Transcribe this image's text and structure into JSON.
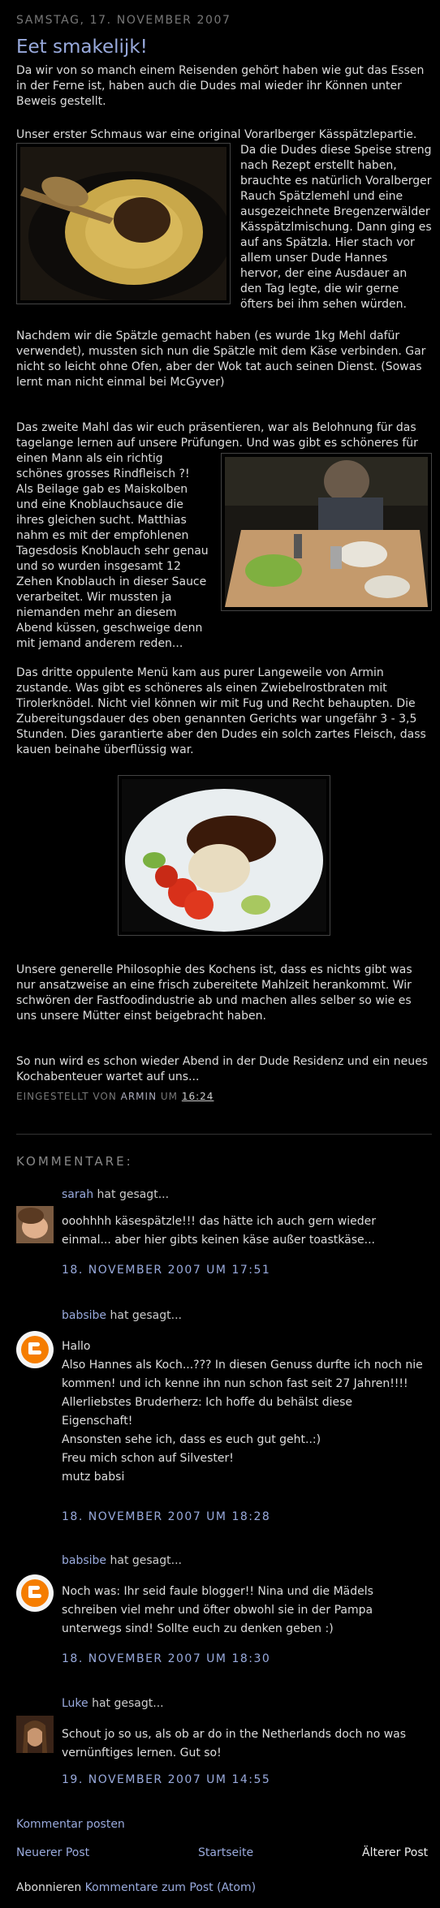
{
  "post": {
    "date": "Samstag, 17. November 2007",
    "title": "Eet smakelijk!",
    "p1": "Da wir von so manch einem Reisenden gehört haben wie gut das Essen in der Ferne ist, haben auch die Dudes mal wieder ihr Können unter Beweis gestellt.",
    "p2_intro": "Unser erster Schmaus war eine original Vorarlberger Kässpätzlepartie.",
    "p2_beside": "Da die Dudes diese Speise streng nach Rezept erstellt haben, brauchte es natürlich Voralberger Rauch Spätzlemehl und eine ausgezeichnete Bregenzerwälder Kässpätzlmischung. Dann ging es auf ans Spätzla. Hier stach vor allem unser Dude Hannes hervor, der eine Ausdauer an den Tag legte, die wir gerne öfters bei ihm sehen würden.",
    "p2_after": "Nachdem wir die Spätzle gemacht haben (es wurde 1kg Mehl dafür verwendet), mussten sich nun die Spätzle mit dem Käse verbinden. Gar nicht so leicht ohne Ofen, aber der Wok tat auch seinen Dienst. (Sowas lernt man nicht einmal bei McGyver)",
    "p3_intro": "Das zweite Mahl das wir euch präsentieren, war als Belohnung für das tagelange lernen auf unsere Prüfungen. Und was gibt es schöneres für",
    "p3_beside": "einen Mann als ein richtig schönes grosses Rindfleisch ?! Als Beilage gab es Maiskolben und eine Knoblauchsauce die ihres gleichen sucht. Matthias nahm es mit der empfohlenen Tagesdosis Knoblauch sehr genau und so wurden insgesamt 12 Zehen Knoblauch in dieser Sauce verarbeitet. Wir mussten ja niemanden mehr an diesem Abend küssen, geschweige denn mit jemand anderem reden...",
    "p4": "Das dritte oppulente Menü kam aus purer Langeweile von Armin zustande. Was gibt es schöneres als einen Zwiebelrostbraten mit Tirolerknödel. Nicht viel können wir mit Fug und Recht behaupten. Die Zubereitungsdauer des oben genannten Gerichts war ungefähr 3 - 3,5 Stunden. Dies garantierte aber den Dudes ein solch zartes Fleisch, dass kauen beinahe überflüssig war.",
    "p5": "Unsere generelle Philosophie des Kochens ist, dass es nichts gibt was nur ansatzweise an eine frisch zubereitete Mahlzeit herankommt. Wir schwören der Fastfoodindustrie ab und machen alles selber so wie es uns unsere Mütter einst beigebracht haben.",
    "p6": "So nun wird es schon wieder Abend in der Dude Residenz und ein neues Kochabenteuer wartet auf uns...",
    "footer_prefix": "Eingestellt von",
    "footer_author": "Armin",
    "footer_um": "um",
    "footer_time": "16:24"
  },
  "comments_header": "Kommentare:",
  "said_label": "hat gesagt...",
  "comments": [
    {
      "author": "sarah",
      "lines": [
        "ooohhhh käsespätzle!!! das hätte ich auch gern wieder",
        "einmal... aber hier gibts keinen käse außer toastkäse..."
      ],
      "date": "18. November 2007 um 17:51"
    },
    {
      "author": "babsibe",
      "lines": [
        "Hallo",
        "Also Hannes als Koch...??? In diesen Genuss durfte ich noch nie",
        "kommen! und ich kenne ihn nun schon fast seit 27 Jahren!!!!",
        "Allerliebstes Bruderherz: Ich hoffe du behälst diese",
        "Eigenschaft!",
        "Ansonsten sehe ich, dass es euch gut geht..:)",
        "Freu mich schon auf Silvester!",
        "mutz babsi"
      ],
      "date": "18. November 2007 um 18:28"
    },
    {
      "author": "babsibe",
      "lines": [
        "Noch was: Ihr seid faule blogger!! Nina und die Mädels",
        "schreiben viel mehr und öfter obwohl sie in der Pampa",
        "unterwegs sind! Sollte euch zu denken geben :)"
      ],
      "date": "18. November 2007 um 18:30"
    },
    {
      "author": "Luke",
      "lines": [
        "Schout jo so us, als ob ar do in the Netherlands doch no was",
        "vernünftiges lernen. Gut so!"
      ],
      "date": "19. November 2007 um 14:55"
    }
  ],
  "nav": {
    "post_comment": "Kommentar posten",
    "newer": "Neuerer Post",
    "home": "Startseite",
    "older": "Älterer Post",
    "subscribe_prefix": "Abonnieren",
    "subscribe_link": "Kommentare zum Post (Atom)"
  },
  "colors": {
    "link": "#99aadd",
    "background": "#000000",
    "text": "#dddddd"
  }
}
